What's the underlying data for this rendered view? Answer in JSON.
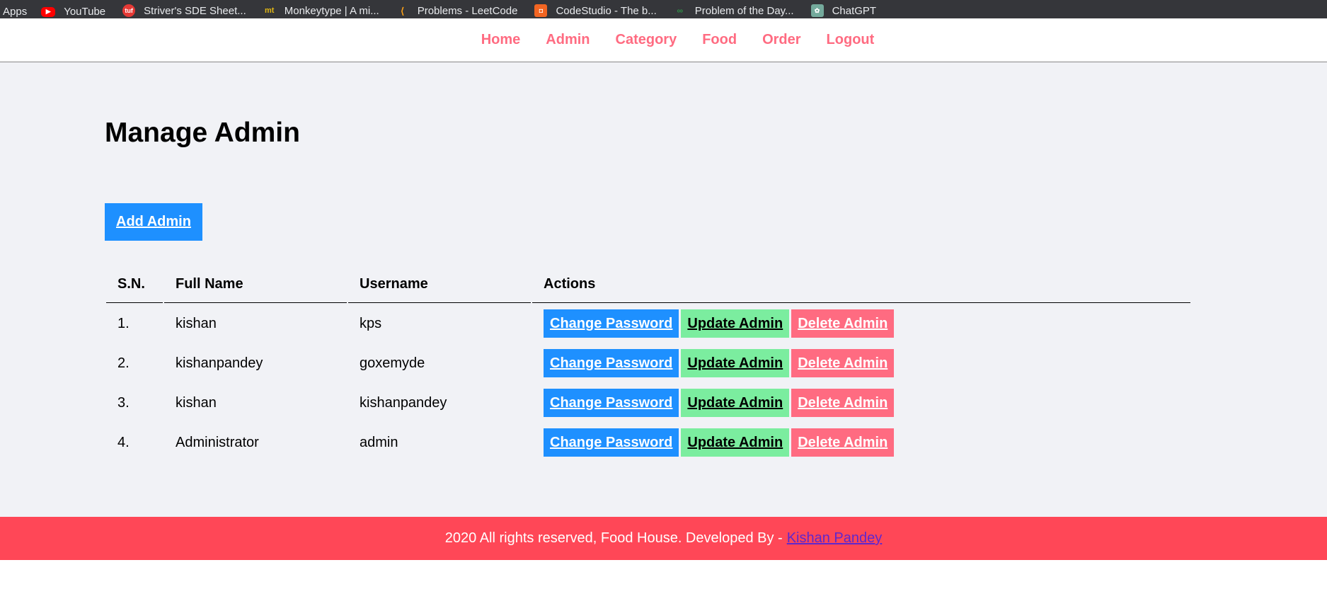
{
  "bookmarks": [
    {
      "label": "Apps",
      "icon": "apps-icon",
      "color": ""
    },
    {
      "label": "YouTube",
      "icon": "youtube-icon",
      "color": "#ff0000"
    },
    {
      "label": "Striver's SDE Sheet...",
      "icon": "tuf-icon",
      "color": "#e53935"
    },
    {
      "label": "Monkeytype | A mi...",
      "icon": "monkeytype-icon",
      "color": "#e2b714"
    },
    {
      "label": "Problems - LeetCode",
      "icon": "leetcode-icon",
      "color": "#ffa116"
    },
    {
      "label": "CodeStudio - The b...",
      "icon": "codestudio-icon",
      "color": "#f26522"
    },
    {
      "label": "Problem of the Day...",
      "icon": "gfg-icon",
      "color": "#2f8d46"
    },
    {
      "label": "ChatGPT",
      "icon": "chatgpt-icon",
      "color": "#74aa9c"
    }
  ],
  "nav": {
    "home": "Home",
    "admin": "Admin",
    "category": "Category",
    "food": "Food",
    "order": "Order",
    "logout": "Logout"
  },
  "page": {
    "title": "Manage Admin",
    "add_button": "Add Admin"
  },
  "table": {
    "headers": [
      "S.N.",
      "Full Name",
      "Username",
      "Actions"
    ],
    "rows": [
      {
        "sn": "1.",
        "full_name": "kishan",
        "username": "kps"
      },
      {
        "sn": "2.",
        "full_name": "kishanpandey",
        "username": "goxemyde"
      },
      {
        "sn": "3.",
        "full_name": "kishan",
        "username": "kishanpandey"
      },
      {
        "sn": "4.",
        "full_name": "Administrator",
        "username": "admin"
      }
    ],
    "actions": {
      "change_password": "Change Password",
      "update": "Update Admin",
      "delete": "Delete Admin"
    }
  },
  "footer": {
    "text": "2020 All rights reserved, Food House. Developed By -",
    "link": "Kishan Pandey"
  },
  "colors": {
    "accent_nav": "#ff6b81",
    "primary": "#1e90ff",
    "success": "#7bed9f",
    "danger": "#ff6b81",
    "footer_bg": "#ff4757"
  }
}
